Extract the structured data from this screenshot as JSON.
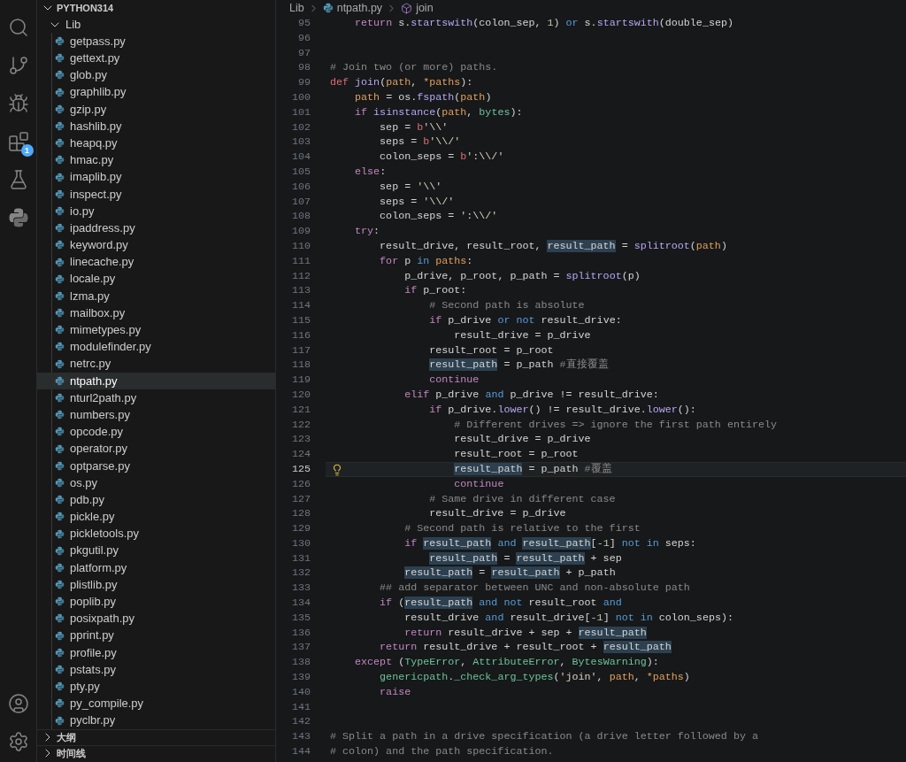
{
  "activity_bar": {
    "badge": "1"
  },
  "explorer": {
    "root": "PYTHON314",
    "root_expanded": true,
    "folder": "Lib",
    "folder_expanded": true,
    "files": [
      {
        "name": "getpass.py",
        "selected": false
      },
      {
        "name": "gettext.py",
        "selected": false
      },
      {
        "name": "glob.py",
        "selected": false
      },
      {
        "name": "graphlib.py",
        "selected": false
      },
      {
        "name": "gzip.py",
        "selected": false
      },
      {
        "name": "hashlib.py",
        "selected": false
      },
      {
        "name": "heapq.py",
        "selected": false
      },
      {
        "name": "hmac.py",
        "selected": false
      },
      {
        "name": "imaplib.py",
        "selected": false
      },
      {
        "name": "inspect.py",
        "selected": false
      },
      {
        "name": "io.py",
        "selected": false
      },
      {
        "name": "ipaddress.py",
        "selected": false
      },
      {
        "name": "keyword.py",
        "selected": false
      },
      {
        "name": "linecache.py",
        "selected": false
      },
      {
        "name": "locale.py",
        "selected": false
      },
      {
        "name": "lzma.py",
        "selected": false
      },
      {
        "name": "mailbox.py",
        "selected": false
      },
      {
        "name": "mimetypes.py",
        "selected": false
      },
      {
        "name": "modulefinder.py",
        "selected": false
      },
      {
        "name": "netrc.py",
        "selected": false
      },
      {
        "name": "ntpath.py",
        "selected": true
      },
      {
        "name": "nturl2path.py",
        "selected": false
      },
      {
        "name": "numbers.py",
        "selected": false
      },
      {
        "name": "opcode.py",
        "selected": false
      },
      {
        "name": "operator.py",
        "selected": false
      },
      {
        "name": "optparse.py",
        "selected": false
      },
      {
        "name": "os.py",
        "selected": false
      },
      {
        "name": "pdb.py",
        "selected": false
      },
      {
        "name": "pickle.py",
        "selected": false
      },
      {
        "name": "pickletools.py",
        "selected": false
      },
      {
        "name": "pkgutil.py",
        "selected": false
      },
      {
        "name": "platform.py",
        "selected": false
      },
      {
        "name": "plistlib.py",
        "selected": false
      },
      {
        "name": "poplib.py",
        "selected": false
      },
      {
        "name": "posixpath.py",
        "selected": false
      },
      {
        "name": "pprint.py",
        "selected": false
      },
      {
        "name": "profile.py",
        "selected": false
      },
      {
        "name": "pstats.py",
        "selected": false
      },
      {
        "name": "pty.py",
        "selected": false
      },
      {
        "name": "py_compile.py",
        "selected": false
      },
      {
        "name": "pyclbr.py",
        "selected": false
      }
    ],
    "sections": [
      {
        "title": "大纲",
        "expanded": false
      },
      {
        "title": "时间线",
        "expanded": false
      }
    ]
  },
  "editor": {
    "breadcrumb": [
      {
        "kind": "folder",
        "text": "Lib"
      },
      {
        "kind": "file",
        "text": "ntpath.py"
      },
      {
        "kind": "symbol",
        "text": "join"
      }
    ],
    "lines": [
      {
        "number": "95",
        "current": false,
        "tokens": [
          {
            "kind": "control",
            "text": "    return"
          },
          {
            "kind": "plain",
            "text": " s."
          },
          {
            "kind": "function",
            "text": "startswith"
          },
          {
            "kind": "plain",
            "text": "(colon_sep, "
          },
          {
            "kind": "number",
            "text": "1"
          },
          {
            "kind": "plain",
            "text": ") "
          },
          {
            "kind": "logic",
            "text": "or"
          },
          {
            "kind": "plain",
            "text": " s."
          },
          {
            "kind": "function",
            "text": "startswith"
          },
          {
            "kind": "plain",
            "text": "(double_sep)"
          }
        ]
      },
      {
        "number": "96",
        "current": false
      },
      {
        "number": "97",
        "current": false
      },
      {
        "number": "98",
        "current": false,
        "tokens": [
          {
            "kind": "comment",
            "text": "# Join two (or more) paths."
          }
        ]
      },
      {
        "number": "99",
        "current": false,
        "tokens": [
          {
            "kind": "decl",
            "text": "def "
          },
          {
            "kind": "function",
            "text": "join"
          },
          {
            "kind": "plain",
            "text": "("
          },
          {
            "kind": "param",
            "text": "path"
          },
          {
            "kind": "plain",
            "text": ", "
          },
          {
            "kind": "param",
            "text": "*paths"
          },
          {
            "kind": "plain",
            "text": "):"
          }
        ]
      },
      {
        "number": "100",
        "current": false,
        "tokens": [
          {
            "kind": "param",
            "text": "    path"
          },
          {
            "kind": "plain",
            "text": " = os."
          },
          {
            "kind": "function",
            "text": "fspath"
          },
          {
            "kind": "plain",
            "text": "("
          },
          {
            "kind": "param",
            "text": "path"
          },
          {
            "kind": "plain",
            "text": ")"
          }
        ]
      },
      {
        "number": "101",
        "current": false,
        "tokens": [
          {
            "kind": "control",
            "text": "    if "
          },
          {
            "kind": "function",
            "text": "isinstance"
          },
          {
            "kind": "plain",
            "text": "("
          },
          {
            "kind": "param",
            "text": "path"
          },
          {
            "kind": "plain",
            "text": ", "
          },
          {
            "kind": "type",
            "text": "bytes"
          },
          {
            "kind": "plain",
            "text": "):"
          }
        ]
      },
      {
        "number": "102",
        "current": false,
        "tokens": [
          {
            "kind": "plain",
            "text": "        sep = "
          },
          {
            "kind": "decl",
            "text": "b"
          },
          {
            "kind": "string",
            "text": "'\\\\'"
          }
        ]
      },
      {
        "number": "103",
        "current": false,
        "tokens": [
          {
            "kind": "plain",
            "text": "        seps = "
          },
          {
            "kind": "decl",
            "text": "b"
          },
          {
            "kind": "string",
            "text": "'\\\\/'"
          }
        ]
      },
      {
        "number": "104",
        "current": false,
        "tokens": [
          {
            "kind": "plain",
            "text": "        colon_seps = "
          },
          {
            "kind": "decl",
            "text": "b"
          },
          {
            "kind": "string",
            "text": "':\\\\/'"
          }
        ]
      },
      {
        "number": "105",
        "current": false,
        "tokens": [
          {
            "kind": "control",
            "text": "    else"
          },
          {
            "kind": "plain",
            "text": ":"
          }
        ]
      },
      {
        "number": "106",
        "current": false,
        "tokens": [
          {
            "kind": "plain",
            "text": "        sep = "
          },
          {
            "kind": "string",
            "text": "'\\\\'"
          }
        ]
      },
      {
        "number": "107",
        "current": false,
        "tokens": [
          {
            "kind": "plain",
            "text": "        seps = "
          },
          {
            "kind": "string",
            "text": "'\\\\/'"
          }
        ]
      },
      {
        "number": "108",
        "current": false,
        "tokens": [
          {
            "kind": "plain",
            "text": "        colon_seps = "
          },
          {
            "kind": "string",
            "text": "':\\\\/'"
          }
        ]
      },
      {
        "number": "109",
        "current": false,
        "tokens": [
          {
            "kind": "control",
            "text": "    try"
          },
          {
            "kind": "plain",
            "text": ":"
          }
        ]
      },
      {
        "number": "110",
        "current": false,
        "tokens": [
          {
            "kind": "plain",
            "text": "        result_drive, result_root, "
          },
          {
            "kind": "highlight",
            "text": "result_path"
          },
          {
            "kind": "plain",
            "text": " = "
          },
          {
            "kind": "function",
            "text": "splitroot"
          },
          {
            "kind": "plain",
            "text": "("
          },
          {
            "kind": "param",
            "text": "path"
          },
          {
            "kind": "plain",
            "text": ")"
          }
        ]
      },
      {
        "number": "111",
        "current": false,
        "tokens": [
          {
            "kind": "control",
            "text": "        for"
          },
          {
            "kind": "plain",
            "text": " p "
          },
          {
            "kind": "logic",
            "text": "in "
          },
          {
            "kind": "param",
            "text": "paths"
          },
          {
            "kind": "plain",
            "text": ":"
          }
        ]
      },
      {
        "number": "112",
        "current": false,
        "tokens": [
          {
            "kind": "plain",
            "text": "            p_drive, p_root, p_path = "
          },
          {
            "kind": "function",
            "text": "splitroot"
          },
          {
            "kind": "plain",
            "text": "(p)"
          }
        ]
      },
      {
        "number": "113",
        "current": false,
        "tokens": [
          {
            "kind": "control",
            "text": "            if"
          },
          {
            "kind": "plain",
            "text": " p_root:"
          }
        ]
      },
      {
        "number": "114",
        "current": false,
        "tokens": [
          {
            "kind": "comment",
            "text": "                # Second path is absolute"
          }
        ]
      },
      {
        "number": "115",
        "current": false,
        "tokens": [
          {
            "kind": "control",
            "text": "                if"
          },
          {
            "kind": "plain",
            "text": " p_drive "
          },
          {
            "kind": "logic",
            "text": "or "
          },
          {
            "kind": "logic",
            "text": "not"
          },
          {
            "kind": "plain",
            "text": " result_drive:"
          }
        ]
      },
      {
        "number": "116",
        "current": false,
        "tokens": [
          {
            "kind": "plain",
            "text": "                    result_drive = p_drive"
          }
        ]
      },
      {
        "number": "117",
        "current": false,
        "tokens": [
          {
            "kind": "plain",
            "text": "                result_root = p_root"
          }
        ]
      },
      {
        "number": "118",
        "current": false,
        "tokens": [
          {
            "kind": "highlight",
            "text": "                result_path"
          },
          {
            "kind": "plain",
            "text": " = p_path "
          },
          {
            "kind": "comment",
            "text": "#直接覆盖"
          }
        ]
      },
      {
        "number": "119",
        "current": false,
        "tokens": [
          {
            "kind": "control",
            "text": "                continue"
          }
        ]
      },
      {
        "number": "120",
        "current": false,
        "tokens": [
          {
            "kind": "control",
            "text": "            elif"
          },
          {
            "kind": "plain",
            "text": " p_drive "
          },
          {
            "kind": "logic",
            "text": "and"
          },
          {
            "kind": "plain",
            "text": " p_drive != result_drive:"
          }
        ]
      },
      {
        "number": "121",
        "current": false,
        "tokens": [
          {
            "kind": "control",
            "text": "                if"
          },
          {
            "kind": "plain",
            "text": " p_drive."
          },
          {
            "kind": "function",
            "text": "lower"
          },
          {
            "kind": "plain",
            "text": "() != result_drive."
          },
          {
            "kind": "function",
            "text": "lower"
          },
          {
            "kind": "plain",
            "text": "():"
          }
        ]
      },
      {
        "number": "122",
        "current": false,
        "tokens": [
          {
            "kind": "comment",
            "text": "                    # Different drives => ignore the first path entirely"
          }
        ]
      },
      {
        "number": "123",
        "current": false,
        "tokens": [
          {
            "kind": "plain",
            "text": "                    result_drive = p_drive"
          }
        ]
      },
      {
        "number": "124",
        "current": false,
        "tokens": [
          {
            "kind": "plain",
            "text": "                    result_root = p_root"
          }
        ]
      },
      {
        "number": "125",
        "current": true,
        "tokens": [
          {
            "kind": "highlight",
            "text": "                    result_path"
          },
          {
            "kind": "plain",
            "text": " = p_path "
          },
          {
            "kind": "comment",
            "text": "#覆盖"
          }
        ]
      },
      {
        "number": "126",
        "current": false,
        "tokens": [
          {
            "kind": "control",
            "text": "                    continue"
          }
        ]
      },
      {
        "number": "127",
        "current": false,
        "tokens": [
          {
            "kind": "comment",
            "text": "                # Same drive in different case"
          }
        ]
      },
      {
        "number": "128",
        "current": false,
        "tokens": [
          {
            "kind": "plain",
            "text": "                result_drive = p_drive"
          }
        ]
      },
      {
        "number": "129",
        "current": false,
        "tokens": [
          {
            "kind": "comment",
            "text": "            # Second path is relative to the first"
          }
        ]
      },
      {
        "number": "130",
        "current": false,
        "tokens": [
          {
            "kind": "control",
            "text": "            if "
          },
          {
            "kind": "highlight",
            "text": "result_path "
          },
          {
            "kind": "logic",
            "text": "and "
          },
          {
            "kind": "highlight",
            "text": "result_path"
          },
          {
            "kind": "plain",
            "text": "["
          },
          {
            "kind": "number",
            "text": "-1"
          },
          {
            "kind": "plain",
            "text": "] "
          },
          {
            "kind": "logic",
            "text": "not "
          },
          {
            "kind": "logic",
            "text": "in"
          },
          {
            "kind": "plain",
            "text": " seps:"
          }
        ]
      },
      {
        "number": "131",
        "current": false,
        "tokens": [
          {
            "kind": "highlight",
            "text": "                result_path"
          },
          {
            "kind": "plain",
            "text": " = "
          },
          {
            "kind": "highlight",
            "text": "result_path"
          },
          {
            "kind": "plain",
            "text": " + sep"
          }
        ]
      },
      {
        "number": "132",
        "current": false,
        "tokens": [
          {
            "kind": "highlight",
            "text": "            result_path"
          },
          {
            "kind": "plain",
            "text": " = "
          },
          {
            "kind": "highlight",
            "text": "result_path"
          },
          {
            "kind": "plain",
            "text": " + p_path"
          }
        ]
      },
      {
        "number": "133",
        "current": false,
        "tokens": [
          {
            "kind": "comment",
            "text": "        ## add separator between UNC and non-absolute path"
          }
        ]
      },
      {
        "number": "134",
        "current": false,
        "tokens": [
          {
            "kind": "control",
            "text": "        if"
          },
          {
            "kind": "plain",
            "text": " ("
          },
          {
            "kind": "highlight",
            "text": "result_path "
          },
          {
            "kind": "logic",
            "text": "and "
          },
          {
            "kind": "logic",
            "text": "not"
          },
          {
            "kind": "plain",
            "text": " result_root "
          },
          {
            "kind": "logic",
            "text": "and"
          }
        ]
      },
      {
        "number": "135",
        "current": false,
        "tokens": [
          {
            "kind": "plain",
            "text": "            result_drive "
          },
          {
            "kind": "logic",
            "text": "and"
          },
          {
            "kind": "plain",
            "text": " result_drive["
          },
          {
            "kind": "number",
            "text": "-1"
          },
          {
            "kind": "plain",
            "text": "] "
          },
          {
            "kind": "logic",
            "text": "not "
          },
          {
            "kind": "logic",
            "text": "in"
          },
          {
            "kind": "plain",
            "text": " colon_seps):"
          }
        ]
      },
      {
        "number": "136",
        "current": false,
        "tokens": [
          {
            "kind": "control",
            "text": "            return"
          },
          {
            "kind": "plain",
            "text": " result_drive + sep + "
          },
          {
            "kind": "highlight",
            "text": "result_path"
          }
        ]
      },
      {
        "number": "137",
        "current": false,
        "tokens": [
          {
            "kind": "control",
            "text": "        return"
          },
          {
            "kind": "plain",
            "text": " result_drive + result_root + "
          },
          {
            "kind": "highlight",
            "text": "result_path"
          }
        ]
      },
      {
        "number": "138",
        "current": false,
        "tokens": [
          {
            "kind": "control",
            "text": "    except"
          },
          {
            "kind": "plain",
            "text": " ("
          },
          {
            "kind": "type",
            "text": "TypeError"
          },
          {
            "kind": "plain",
            "text": ", "
          },
          {
            "kind": "type",
            "text": "AttributeError"
          },
          {
            "kind": "plain",
            "text": ", "
          },
          {
            "kind": "type",
            "text": "BytesWarning"
          },
          {
            "kind": "plain",
            "text": "):"
          }
        ]
      },
      {
        "number": "139",
        "current": false,
        "tokens": [
          {
            "kind": "type",
            "text": "        genericpath"
          },
          {
            "kind": "plain",
            "text": "."
          },
          {
            "kind": "type",
            "text": "_check_arg_types"
          },
          {
            "kind": "plain",
            "text": "("
          },
          {
            "kind": "string",
            "text": "'join'"
          },
          {
            "kind": "plain",
            "text": ", "
          },
          {
            "kind": "param",
            "text": "path"
          },
          {
            "kind": "plain",
            "text": ", "
          },
          {
            "kind": "param",
            "text": "*paths"
          },
          {
            "kind": "plain",
            "text": ")"
          }
        ]
      },
      {
        "number": "140",
        "current": false,
        "tokens": [
          {
            "kind": "control",
            "text": "        raise"
          }
        ]
      },
      {
        "number": "141",
        "current": false
      },
      {
        "number": "142",
        "current": false
      },
      {
        "number": "143",
        "current": false,
        "tokens": [
          {
            "kind": "comment",
            "text": "# Split a path in a drive specification (a drive letter followed by a"
          }
        ]
      },
      {
        "number": "144",
        "current": false,
        "tokens": [
          {
            "kind": "comment",
            "text": "# colon) and the path specification."
          }
        ]
      }
    ]
  }
}
